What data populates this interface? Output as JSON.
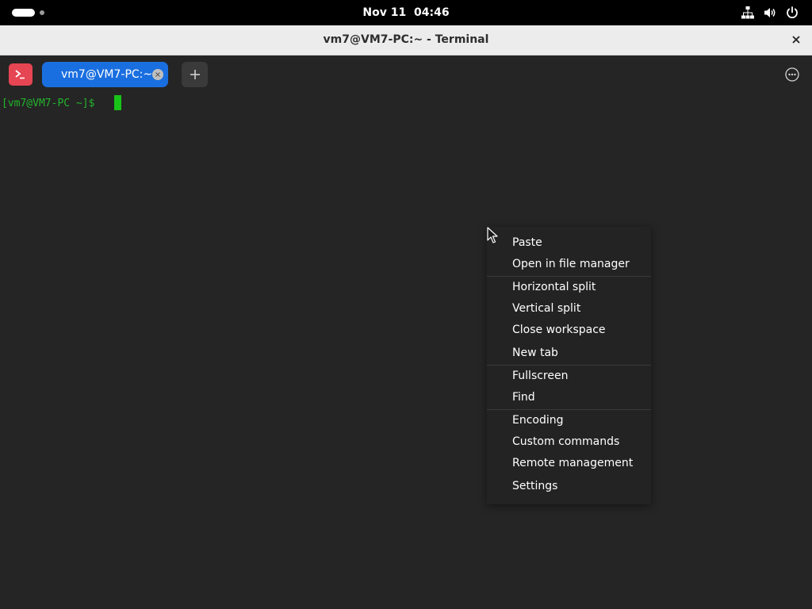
{
  "topbar": {
    "date": "Nov 11",
    "time": "04:46",
    "icons": [
      "activities-indicator",
      "network-icon",
      "volume-icon",
      "power-icon"
    ]
  },
  "window": {
    "title": "vm7@VM7-PC:~ - Terminal"
  },
  "tabs": {
    "items": [
      {
        "label": "vm7@VM7-PC:~"
      }
    ]
  },
  "terminal": {
    "prompt": "[vm7@VM7-PC ~]$ ",
    "prompt_color": "#23b52a",
    "cursor_color": "#18c418"
  },
  "context_menu": {
    "groups": [
      [
        "Paste",
        "Open in file manager"
      ],
      [
        "Horizontal split",
        "Vertical split",
        "Close workspace",
        "New tab"
      ],
      [
        "Fullscreen",
        "Find"
      ],
      [
        "Encoding",
        "Custom commands",
        "Remote management",
        "Settings"
      ]
    ],
    "items": {
      "paste": "Paste",
      "open_in_file_manager": "Open in file manager",
      "horizontal_split": "Horizontal split",
      "vertical_split": "Vertical split",
      "close_workspace": "Close workspace",
      "new_tab": "New tab",
      "fullscreen": "Fullscreen",
      "find": "Find",
      "encoding": "Encoding",
      "custom_commands": "Custom commands",
      "remote_management": "Remote management",
      "settings": "Settings"
    }
  },
  "colors": {
    "accent_tab": "#1a6fe0",
    "app_icon": "#e64553",
    "background": "#252525"
  }
}
